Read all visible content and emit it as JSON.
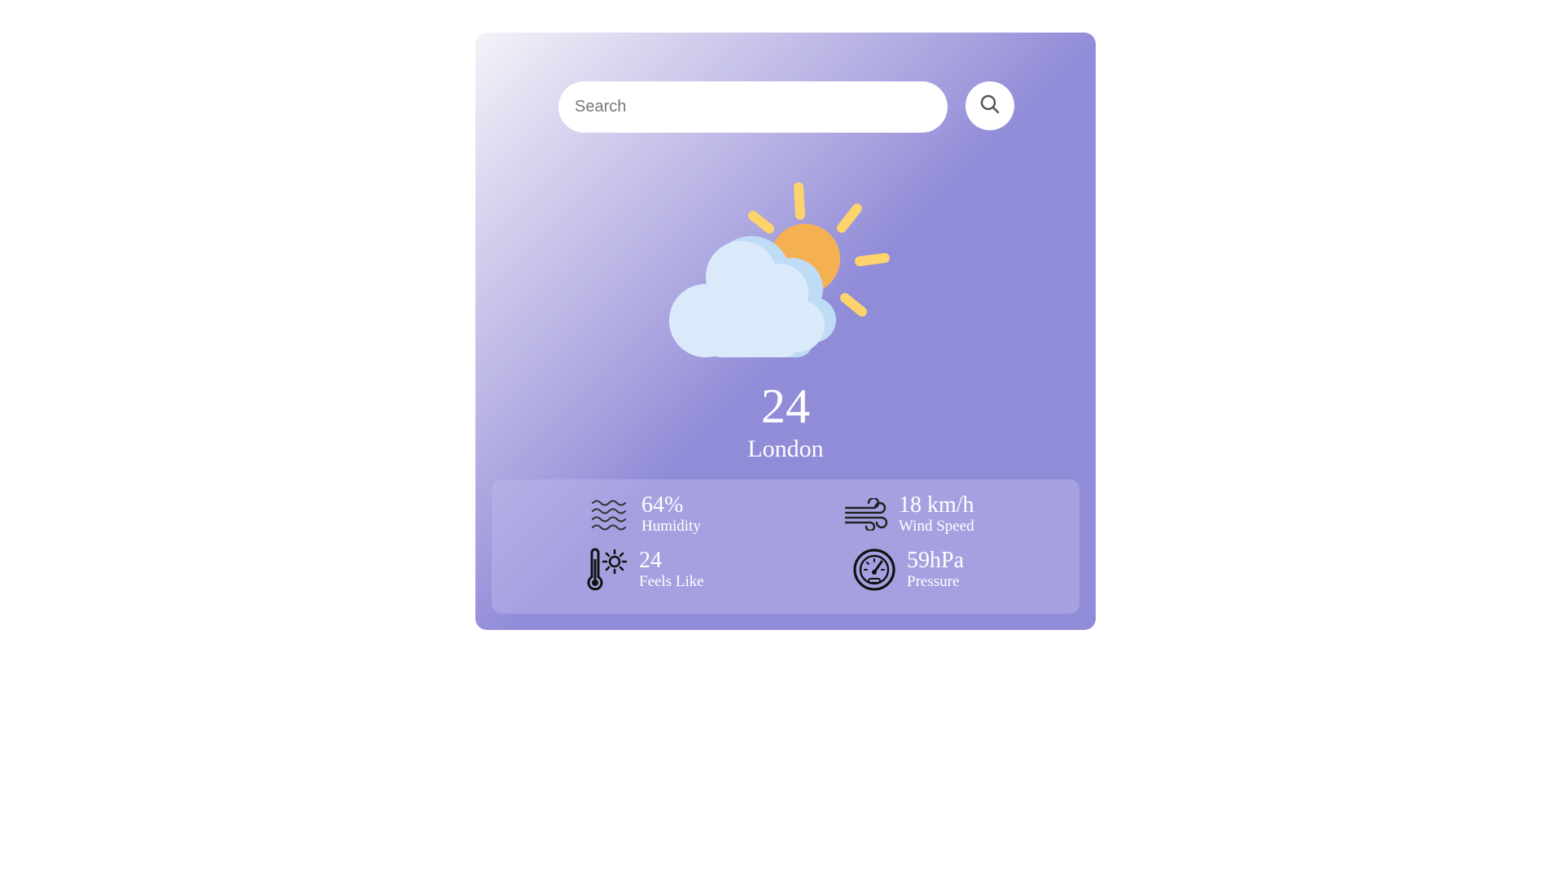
{
  "search": {
    "placeholder": "Search",
    "icon": "search-icon"
  },
  "weather": {
    "icon": "partly-cloudy-icon",
    "temperature": "24",
    "city": "London"
  },
  "details": {
    "humidity": {
      "value": "64%",
      "label": "Humidity",
      "icon": "waves-icon"
    },
    "wind": {
      "value": "18 km/h",
      "label": "Wind Speed",
      "icon": "wind-icon"
    },
    "feels_like": {
      "value": "24",
      "label": "Feels Like",
      "icon": "thermometer-sun-icon"
    },
    "pressure": {
      "value": "59hPa",
      "label": "Pressure",
      "icon": "gauge-icon"
    }
  },
  "colors": {
    "card_gradient_start": "#f4f3f8",
    "card_gradient_end": "#908cd8",
    "sun": "#f5b052",
    "sun_rays": "#fdd36b",
    "cloud": "#dbeafb",
    "text": "#ffffff"
  }
}
